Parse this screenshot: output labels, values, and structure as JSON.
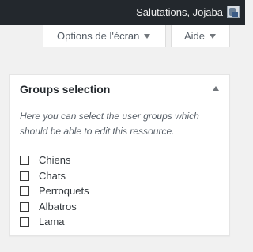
{
  "adminbar": {
    "greeting": "Salutations, Jojaba",
    "avatar_icon": "user-avatar-icon"
  },
  "screen_meta": {
    "screen_options_label": "Options de l'écran",
    "help_label": "Aide",
    "arrow_icon": "caret-down-icon"
  },
  "metabox": {
    "title": "Groups selection",
    "toggle_icon": "caret-up-icon",
    "description": "Here you can select the user groups which should be able to edit this ressource.",
    "groups": [
      {
        "label": "Chiens",
        "checked": false
      },
      {
        "label": "Chats",
        "checked": false
      },
      {
        "label": "Perroquets",
        "checked": false
      },
      {
        "label": "Albatros",
        "checked": false
      },
      {
        "label": "Lama",
        "checked": false
      }
    ]
  },
  "colors": {
    "adminbar_bg": "#23282d",
    "page_bg": "#f1f1f1",
    "panel_bg": "#ffffff"
  }
}
